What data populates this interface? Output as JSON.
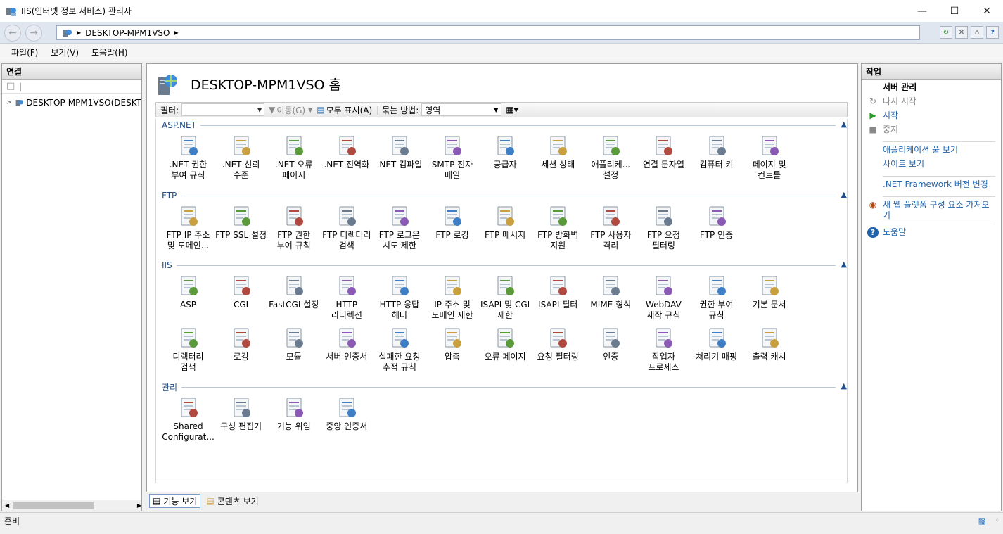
{
  "window": {
    "title": "IIS(인터넷 정보 서비스) 관리자"
  },
  "address": {
    "breadcrumb": "DESKTOP-MPM1VSO"
  },
  "menu": [
    {
      "label": "파일(F)"
    },
    {
      "label": "보기(V)"
    },
    {
      "label": "도움말(H)"
    }
  ],
  "connections": {
    "header": "연결",
    "tree_root": "DESKTOP-MPM1VSO(DESKT"
  },
  "home": {
    "title": "DESKTOP-MPM1VSO 홈",
    "filter_label": "필터:",
    "go_label": "이동(G)",
    "show_all_label": "모두 표시(A)",
    "group_by_label": "묶는 방법:",
    "group_by_value": "영역"
  },
  "groups": [
    {
      "title": "ASP.NET",
      "items": [
        {
          "label": ".NET 권한\n부여 규칙",
          "icon": "lock-icon"
        },
        {
          "label": ".NET 신뢰\n수준",
          "icon": "trust-icon"
        },
        {
          "label": ".NET 오류\n페이지",
          "icon": "error-page-icon"
        },
        {
          "label": ".NET 전역화",
          "icon": "globe-icon"
        },
        {
          "label": ".NET 컴파일",
          "icon": "compile-icon"
        },
        {
          "label": "SMTP 전자\n메일",
          "icon": "email-icon"
        },
        {
          "label": "공급자",
          "icon": "providers-icon"
        },
        {
          "label": "세션 상태",
          "icon": "session-icon"
        },
        {
          "label": "애플리케...\n설정",
          "icon": "settings-list-icon"
        },
        {
          "label": "연결 문자열",
          "icon": "connection-string-icon"
        },
        {
          "label": "컴퓨터 키",
          "icon": "machine-key-icon"
        },
        {
          "label": "페이지 및\n컨트롤",
          "icon": "pages-controls-icon"
        }
      ]
    },
    {
      "title": "FTP",
      "items": [
        {
          "label": "FTP IP 주소\n및 도메인...",
          "icon": "ftp-ip-icon"
        },
        {
          "label": "FTP SSL 설정",
          "icon": "ftp-ssl-icon"
        },
        {
          "label": "FTP 권한\n부여 규칙",
          "icon": "ftp-auth-rules-icon"
        },
        {
          "label": "FTP 디렉터리\n검색",
          "icon": "ftp-dir-icon"
        },
        {
          "label": "FTP 로그온\n시도 제한",
          "icon": "ftp-logon-icon"
        },
        {
          "label": "FTP 로깅",
          "icon": "ftp-logging-icon"
        },
        {
          "label": "FTP 메시지",
          "icon": "ftp-message-icon"
        },
        {
          "label": "FTP 방화벽\n지원",
          "icon": "ftp-firewall-icon"
        },
        {
          "label": "FTP 사용자\n격리",
          "icon": "ftp-user-isolation-icon"
        },
        {
          "label": "FTP 요청\n필터링",
          "icon": "ftp-request-filter-icon"
        },
        {
          "label": "FTP 인증",
          "icon": "ftp-authentication-icon"
        }
      ]
    },
    {
      "title": "IIS",
      "items": [
        {
          "label": "ASP",
          "icon": "asp-icon"
        },
        {
          "label": "CGI",
          "icon": "cgi-icon"
        },
        {
          "label": "FastCGI 설정",
          "icon": "fastcgi-icon"
        },
        {
          "label": "HTTP\n리디렉션",
          "icon": "http-redirect-icon"
        },
        {
          "label": "HTTP 응답\n헤더",
          "icon": "http-headers-icon"
        },
        {
          "label": "IP 주소 및\n도메인 제한",
          "icon": "ip-restrictions-icon"
        },
        {
          "label": "ISAPI 및 CGI\n제한",
          "icon": "isapi-cgi-icon"
        },
        {
          "label": "ISAPI 필터",
          "icon": "isapi-filter-icon"
        },
        {
          "label": "MIME 형식",
          "icon": "mime-icon"
        },
        {
          "label": "WebDAV\n제작 규칙",
          "icon": "webdav-icon"
        },
        {
          "label": "권한 부여\n규칙",
          "icon": "authorization-icon"
        },
        {
          "label": "기본 문서",
          "icon": "default-document-icon"
        },
        {
          "label": "디렉터리\n검색",
          "icon": "directory-browsing-icon"
        },
        {
          "label": "로깅",
          "icon": "logging-icon"
        },
        {
          "label": "모듈",
          "icon": "modules-icon"
        },
        {
          "label": "서버 인증서",
          "icon": "server-certificates-icon"
        },
        {
          "label": "실패한 요청\n추적 규칙",
          "icon": "failed-request-icon"
        },
        {
          "label": "압축",
          "icon": "compression-icon"
        },
        {
          "label": "오류 페이지",
          "icon": "error-pages-icon"
        },
        {
          "label": "요청 필터링",
          "icon": "request-filtering-icon"
        },
        {
          "label": "인증",
          "icon": "authentication-icon"
        },
        {
          "label": "작업자\n프로세스",
          "icon": "worker-process-icon"
        },
        {
          "label": "처리기 매핑",
          "icon": "handler-mappings-icon"
        },
        {
          "label": "출력 캐시",
          "icon": "output-cache-icon"
        }
      ]
    },
    {
      "title": "관리",
      "items": [
        {
          "label": "Shared\nConfigurat...",
          "icon": "shared-config-icon"
        },
        {
          "label": "구성 편집기",
          "icon": "config-editor-icon"
        },
        {
          "label": "기능 위임",
          "icon": "feature-delegation-icon"
        },
        {
          "label": "중앙 인증서",
          "icon": "central-cert-icon"
        }
      ]
    }
  ],
  "tabs": {
    "features": "기능 보기",
    "content": "콘텐츠 보기"
  },
  "actions": {
    "header": "작업",
    "server_manage": "서버 관리",
    "restart": "다시 시작",
    "start": "시작",
    "stop": "중지",
    "view_app_pools": "애플리케이션 풀 보기",
    "view_sites": "사이트 보기",
    "net_framework": ".NET Framework 버전 변경",
    "get_new_components": "새 웹 플랫폼 구성 요소 가져오기",
    "help": "도움말"
  },
  "status": {
    "text": "준비"
  },
  "colors": {
    "accent": "#1f63ad",
    "group_title": "#1f4e8c"
  }
}
